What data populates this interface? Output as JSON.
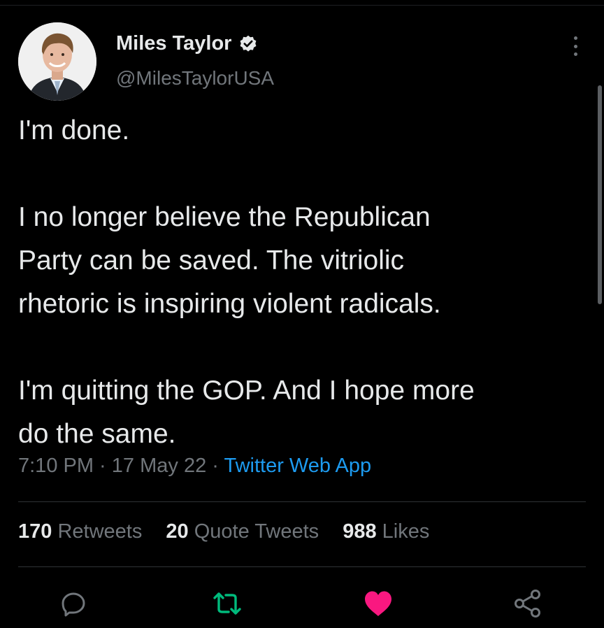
{
  "author": {
    "name": "Miles Taylor",
    "handle": "@MilesTaylorUSA",
    "verified_icon": "verified-badge-icon"
  },
  "tweet": {
    "paragraphs": [
      "I'm done.",
      "I no longer believe the Republican\nParty can be saved.  The vitriolic\nrhetoric is inspiring violent radicals.",
      "I'm quitting the GOP. And I hope more\ndo the same."
    ]
  },
  "meta": {
    "time": "7:10 PM",
    "date": "17 May 22",
    "separator": " · ",
    "source": "Twitter Web App"
  },
  "stats": {
    "retweets": {
      "count": "170",
      "label": "Retweets"
    },
    "quotes": {
      "count": "20",
      "label": "Quote Tweets"
    },
    "likes": {
      "count": "988",
      "label": "Likes"
    }
  },
  "actions": {
    "reply_icon": "reply-icon",
    "retweet_icon": "retweet-icon",
    "like_icon": "heart-icon",
    "share_icon": "share-icon"
  },
  "colors": {
    "background": "#000000",
    "text": "#e7e9ea",
    "secondary": "#71767b",
    "link": "#1d9bf0",
    "retweeted": "#00ba7c",
    "liked": "#f91880"
  }
}
